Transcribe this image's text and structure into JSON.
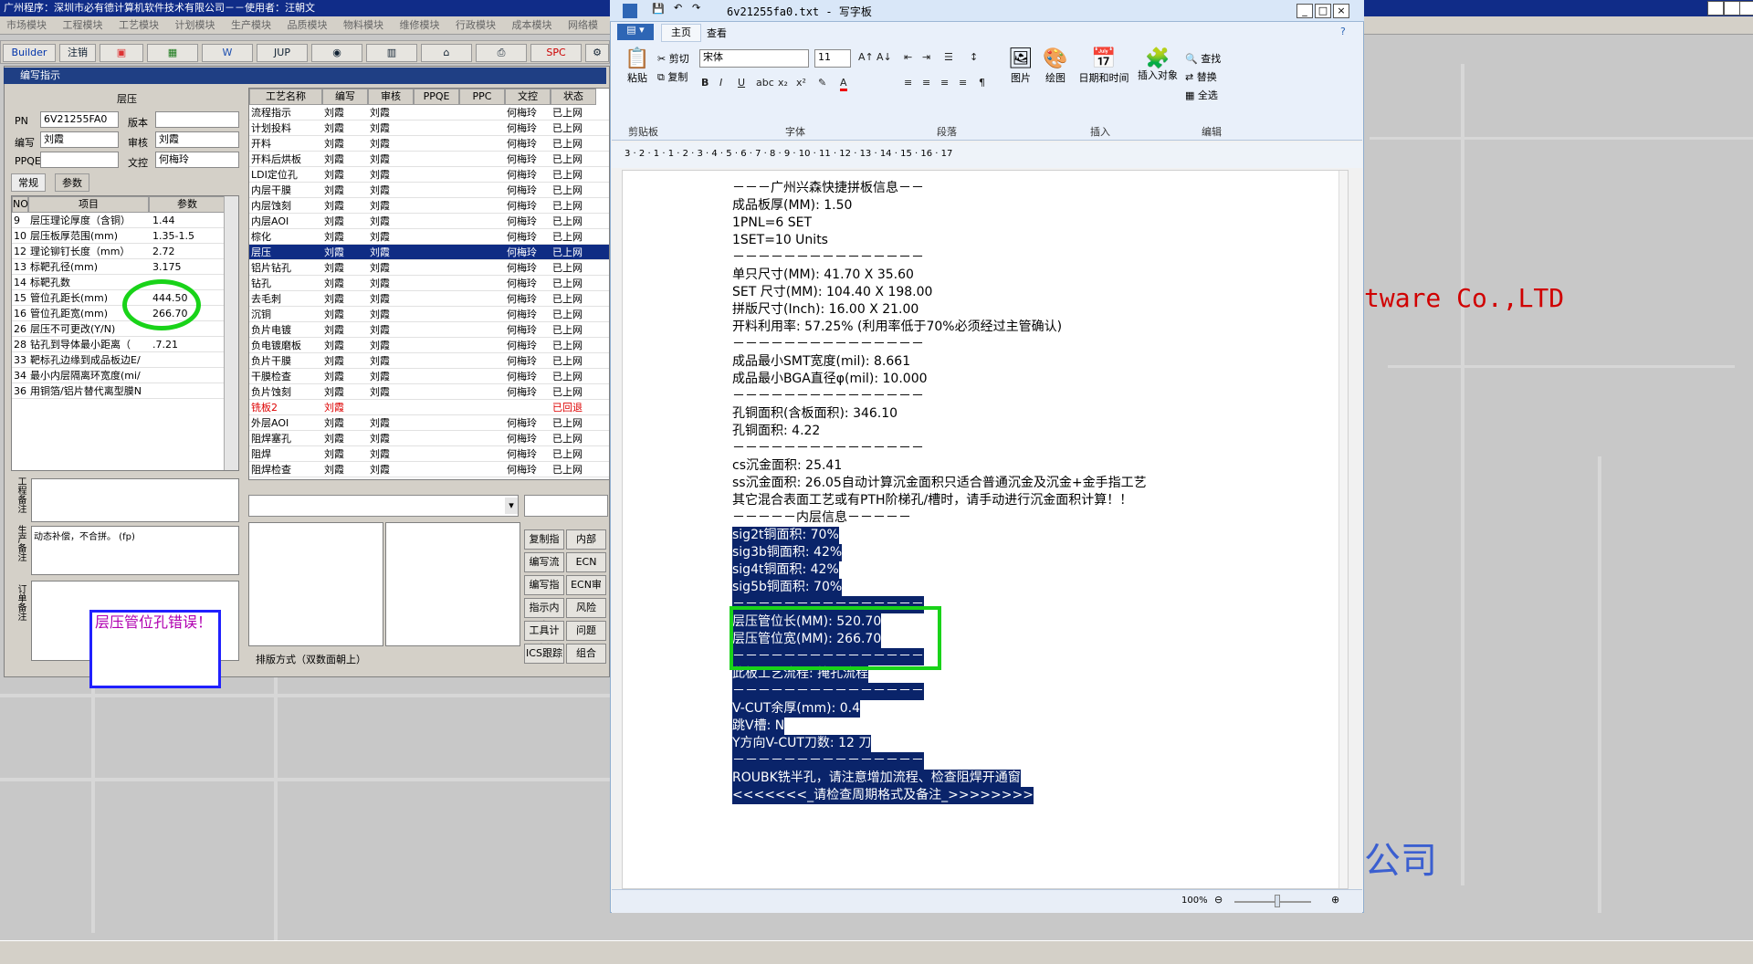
{
  "app": {
    "titlebar": "广州程序：深圳市必有德计算机软件技术有限公司－－使用者：汪朝文",
    "menus": [
      "市场模块",
      "工程模块",
      "工艺模块",
      "计划模块",
      "生产模块",
      "品质模块",
      "物料模块",
      "维修模块",
      "行政模块",
      "成本模块",
      "网络模"
    ],
    "toolbar": [
      "Builder",
      "注销",
      "",
      "",
      "",
      "JUP",
      "",
      "",
      "",
      "SPC",
      ""
    ],
    "panel_title": "编写指示",
    "section_title": "层压",
    "fields": {
      "pn_label": "PN",
      "pn": "6V21255FA0",
      "version_label": "版本",
      "writer_label": "编写",
      "writer": "刘霞",
      "auditor_label": "审核",
      "auditor": "刘霞",
      "ppqe_label": "PPQE",
      "doc_label": "文控",
      "doc": "何梅玲"
    },
    "tabs": [
      "常规",
      "参数"
    ],
    "param_headers": [
      "NO",
      "项目",
      "参数"
    ],
    "params": [
      [
        "9",
        "层压理论厚度（含铜）",
        "1.44"
      ],
      [
        "10",
        "层压板厚范围(mm)",
        "1.35-1.5"
      ],
      [
        "12",
        "理论铆钉长度（mm）",
        "2.72"
      ],
      [
        "13",
        "标靶孔径(mm)",
        "3.175"
      ],
      [
        "14",
        "标靶孔数",
        ""
      ],
      [
        "15",
        "管位孔距长(mm)",
        "444.50"
      ],
      [
        "16",
        "管位孔距宽(mm)",
        "266.70"
      ],
      [
        "26",
        "层压不可更改(Y/N)",
        ""
      ],
      [
        "28",
        "钻孔到导体最小距离（",
        ".7.21"
      ],
      [
        "33",
        "靶标孔边缘到成品板边E/",
        ""
      ],
      [
        "34",
        "最小内层隔离环宽度(mi/",
        ""
      ],
      [
        "36",
        "用铜箔/铝片替代离型膜N",
        ""
      ]
    ],
    "process_headers": [
      "工艺名称",
      "编写",
      "审核",
      "PPQE",
      "PPC",
      "文控",
      "状态"
    ],
    "processes": [
      [
        "流程指示",
        "刘霞",
        "刘霞",
        "",
        "",
        "何梅玲",
        "已上网"
      ],
      [
        "计划投料",
        "刘霞",
        "刘霞",
        "",
        "",
        "何梅玲",
        "已上网"
      ],
      [
        "开料",
        "刘霞",
        "刘霞",
        "",
        "",
        "何梅玲",
        "已上网"
      ],
      [
        "开料后烘板",
        "刘霞",
        "刘霞",
        "",
        "",
        "何梅玲",
        "已上网"
      ],
      [
        "LDI定位孔",
        "刘霞",
        "刘霞",
        "",
        "",
        "何梅玲",
        "已上网"
      ],
      [
        "内层干膜",
        "刘霞",
        "刘霞",
        "",
        "",
        "何梅玲",
        "已上网"
      ],
      [
        "内层蚀刻",
        "刘霞",
        "刘霞",
        "",
        "",
        "何梅玲",
        "已上网"
      ],
      [
        "内层AOI",
        "刘霞",
        "刘霞",
        "",
        "",
        "何梅玲",
        "已上网"
      ],
      [
        "棕化",
        "刘霞",
        "刘霞",
        "",
        "",
        "何梅玲",
        "已上网"
      ],
      [
        "层压",
        "刘霞",
        "刘霞",
        "",
        "",
        "何梅玲",
        "已上网"
      ],
      [
        "铝片钻孔",
        "刘霞",
        "刘霞",
        "",
        "",
        "何梅玲",
        "已上网"
      ],
      [
        "钻孔",
        "刘霞",
        "刘霞",
        "",
        "",
        "何梅玲",
        "已上网"
      ],
      [
        "去毛刺",
        "刘霞",
        "刘霞",
        "",
        "",
        "何梅玲",
        "已上网"
      ],
      [
        "沉铜",
        "刘霞",
        "刘霞",
        "",
        "",
        "何梅玲",
        "已上网"
      ],
      [
        "负片电镀",
        "刘霞",
        "刘霞",
        "",
        "",
        "何梅玲",
        "已上网"
      ],
      [
        "负电镀磨板",
        "刘霞",
        "刘霞",
        "",
        "",
        "何梅玲",
        "已上网"
      ],
      [
        "负片干膜",
        "刘霞",
        "刘霞",
        "",
        "",
        "何梅玲",
        "已上网"
      ],
      [
        "干膜检查",
        "刘霞",
        "刘霞",
        "",
        "",
        "何梅玲",
        "已上网"
      ],
      [
        "负片蚀刻",
        "刘霞",
        "刘霞",
        "",
        "",
        "何梅玲",
        "已上网"
      ],
      [
        "铣板2",
        "刘霞",
        "",
        "",
        "",
        "",
        "已回退"
      ],
      [
        "外层AOI",
        "刘霞",
        "刘霞",
        "",
        "",
        "何梅玲",
        "已上网"
      ],
      [
        "阻焊塞孔",
        "刘霞",
        "刘霞",
        "",
        "",
        "何梅玲",
        "已上网"
      ],
      [
        "阻焊",
        "刘霞",
        "刘霞",
        "",
        "",
        "何梅玲",
        "已上网"
      ],
      [
        "阻焊检查",
        "刘霞",
        "刘霞",
        "",
        "",
        "何梅玲",
        "已上网"
      ]
    ],
    "left_notes": {
      "eng": "工程备注",
      "prod": "生产备注",
      "note": "动态补偿，不合拼。 (fp)",
      "order": "订单备注"
    },
    "error_note": "层压管位孔错误！",
    "arrange": "排版方式（双数面朝上）",
    "right_buttons": [
      "复制指示",
      "内部",
      "编写流程",
      "ECN",
      "编写指示",
      "ECN审",
      "指示内审",
      "风险",
      "工具计划",
      "问题",
      "ICS跟踪",
      "组合"
    ]
  },
  "wordpad": {
    "title": "6v21255fa0.txt - 写字板",
    "tabs": [
      "主页",
      "查看"
    ],
    "clipboard": {
      "paste": "粘贴",
      "cut": "剪切",
      "copy": "复制",
      "group": "剪贴板"
    },
    "font": {
      "name": "宋体",
      "size": "11",
      "group": "字体"
    },
    "paragraph_group": "段落",
    "insert": {
      "picture": "图片",
      "paint": "绘图",
      "datetime": "日期和时间",
      "object": "插入对象",
      "group": "插入"
    },
    "edit": {
      "find": "查找",
      "replace": "替换",
      "select_all": "全选",
      "group": "编辑"
    },
    "zoom": "100%",
    "ruler": "3 · 2 · 1 · 1 · 2 · 3 · 4 · 5 · 6 · 7 · 8 · 9 · 10 · 11 · 12 · 13 · 14 · 15 · 16 · 17",
    "doc_lines": [
      "－－－广州兴森快捷拼板信息－－",
      "成品板厚(MM): 1.50",
      "1PNL=6 SET",
      "1SET=10 Units",
      "－－－－－－－－－－－－－－－",
      "单只尺寸(MM): 41.70 X 35.60",
      "SET 尺寸(MM): 104.40 X 198.00",
      "拼版尺寸(Inch): 16.00 X 21.00",
      "开料利用率: 57.25% (利用率低于70%必须经过主管确认)",
      "－－－－－－－－－－－－－－－",
      "成品最小SMT宽度(mil): 8.661",
      "成品最小BGA直径φ(mil): 10.000",
      "－－－－－－－－－－－－－－－",
      "孔铜面积(含板面积): 346.10",
      "孔铜面积: 4.22",
      "－－－－－－－－－－－－－－－",
      "cs沉金面积: 25.41",
      "ss沉金面积: 26.05自动计算沉金面积只适合普通沉金及沉金+金手指工艺",
      "其它混合表面工艺或有PTH阶梯孔/槽时，请手动进行沉金面积计算！！",
      "－－－－－内层信息－－－－－",
      "sig2t铜面积: 70%",
      "sig3b铜面积: 42%",
      "sig4t铜面积: 42%",
      "sig5b铜面积: 70%",
      "－－－－－－－－－－－－－－－",
      "层压管位长(MM): 520.70",
      "层压管位宽(MM): 266.70",
      "－－－－－－－－－－－－－－－",
      "此板工艺流程: 掩孔流程",
      "－－－－－－－－－－－－－－－",
      "V-CUT余厚(mm): 0.4",
      "跳V槽: N",
      "Y方向V-CUT刀数: 12 刀",
      "－－－－－－－－－－－－－－－",
      "ROUBK铣半孔，请注意增加流程、检查阻焊开通窗",
      "<<<<<<<_请检查周期格式及备注_>>>>>>>>"
    ]
  },
  "background": {
    "company": "tware Co.,LTD",
    "company_cn": "公司"
  },
  "colors": {
    "highlight": "#0f2c84",
    "annotation": "#19d319",
    "accent_red": "#d00000"
  }
}
